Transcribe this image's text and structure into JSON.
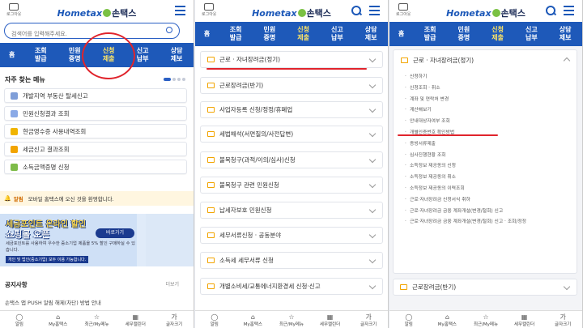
{
  "common": {
    "login_label": "로그아웃",
    "logo_en": "Hometax",
    "logo_ko": "손택스"
  },
  "panel1": {
    "search_placeholder": "검색어를 입력해주세요.",
    "nav": [
      "홈",
      "조회\n발급",
      "민원\n증명",
      "신청\n제출",
      "신고\n납부",
      "상담\n제보"
    ],
    "quick_title": "자주 찾는 메뉴",
    "quick_items": [
      {
        "label": "개발지역 부동산 탈세신고",
        "color": "#7f9ed8"
      },
      {
        "label": "민원신청결과 조회",
        "color": "#8aa9e6"
      },
      {
        "label": "현금영수증 사용내역조회",
        "color": "#f0b400"
      },
      {
        "label": "세금신고 결과조회",
        "color": "#f2a400"
      },
      {
        "label": "소득금액증명 신청",
        "color": "#7dbb48"
      }
    ],
    "notice_tag": "알림",
    "notice_text": "모바일 홈택스에 오신 것을 환영합니다.",
    "banner_line1": "세금포인트 온라인 할인",
    "banner_line2": "쇼핑몰 오픈",
    "banner_button": "바로가기",
    "banner_desc": "세금포인트를 사용하여 우수한 중소기업 제품을 5% 할인 구매하실 수 있습니다.",
    "banner_tag": "개인 및 법인(중소기업)",
    "banner_suffix": "모두 이용 가능합니다.",
    "notice_title": "공지사항",
    "notice_more": "더보기",
    "notice_line": "손택스 앱 PUSH 알림 해제(차단) 방법 안내"
  },
  "panel2": {
    "nav": [
      "홈",
      "조회\n발급",
      "민원\n증명",
      "신청\n제출",
      "신고\n납부",
      "상담\n제보"
    ],
    "menu": [
      "근로 · 자녀장려금(정기)",
      "근로장려금(반기)",
      "사업자등록 신청/정정/휴폐업",
      "세법해석(서면질의/사전답변)",
      "불복청구(과적/이의/심사)신청",
      "불복청구 관련 민원신청",
      "납세자보호 민원신청",
      "세무서류신청 · 공동분야",
      "소득세 세무서류 신청",
      "개별소비세/교통에너지환경세 신청·신고"
    ]
  },
  "panel3": {
    "nav": [
      "홈",
      "조회\n발급",
      "민원\n증명",
      "신청\n제출",
      "신고\n납부",
      "상담\n제보"
    ],
    "section_title": "근로 · 자녀장려금(정기)",
    "sub_items": [
      "신청하기",
      "신청조회 · 취소",
      "계좌 및 연락처 변경",
      "계산해보기",
      "안내대상자여부 조회",
      "개별인증번호 확인방법",
      "증빙서류제출",
      "심사진행현황 조회",
      "소득정보 제공동의 신청",
      "소득정보 제공동의 취소",
      "소득정보 제공동의 이력조회",
      "근로·자녀장려금 신청서식 취하",
      "근로·자녀장려금 금융 계좌개설(변경/철회) 신고",
      "근로·자녀장려금 금융 계좌개설(변경/철회) 신고 · 조회/정정"
    ],
    "next_item": "근로장려금(반기)"
  },
  "bottom_nav": [
    {
      "glyph": "◯",
      "label": "알림"
    },
    {
      "glyph": "⌂",
      "label": "My홈택스"
    },
    {
      "glyph": "☆",
      "label": "최근/My메뉴"
    },
    {
      "glyph": "▦",
      "label": "세무캘린더"
    },
    {
      "glyph": "가",
      "label": "글자크기"
    }
  ],
  "colors": {
    "brand_blue": "#1e59b9",
    "active_tab": "#ffe566",
    "annotation_red": "#e0242c"
  }
}
